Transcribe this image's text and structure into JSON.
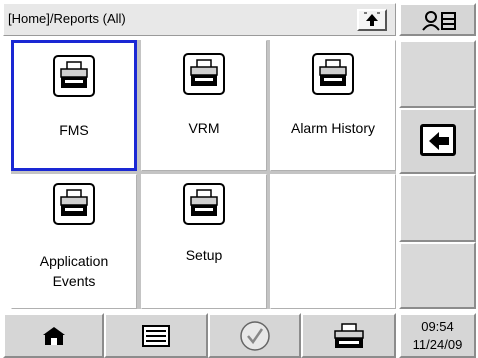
{
  "breadcrumb": {
    "path": "[Home]/Reports (All)"
  },
  "icons": {
    "up": "up-arrow-icon",
    "user_list": "user-list-icon",
    "back": "back-arrow-icon",
    "report": "printer-icon",
    "home": "home-icon",
    "list": "list-icon",
    "check": "checkmark-icon",
    "print": "printer-icon"
  },
  "tiles": [
    {
      "label": "FMS",
      "selected": true
    },
    {
      "label": "VRM",
      "selected": false
    },
    {
      "label": "Alarm History",
      "selected": false
    },
    {
      "label_line1": "Application",
      "label_line2": "Events",
      "selected": false
    },
    {
      "label": "Setup",
      "selected": false
    }
  ],
  "colors": {
    "selection": "#1a28d4",
    "panel": "#d6d6d6",
    "grid_gap": "#c4c4c4"
  },
  "clock": {
    "time": "09:54",
    "date": "11/24/09"
  }
}
